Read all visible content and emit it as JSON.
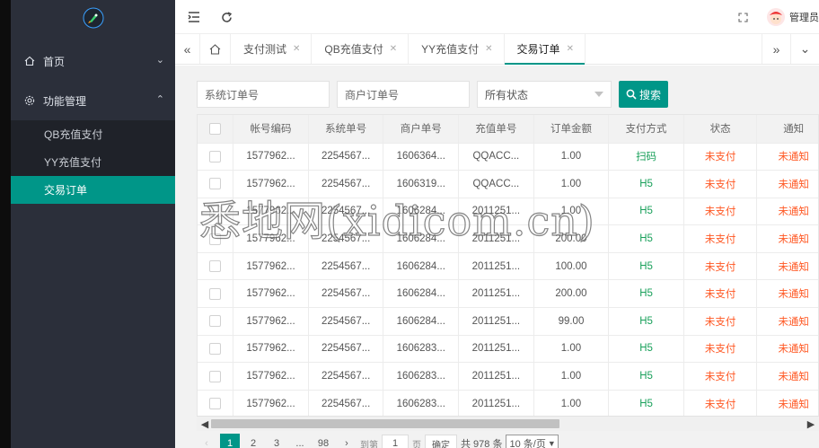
{
  "sidebar": {
    "menu": [
      {
        "label": "首页"
      },
      {
        "label": "功能管理"
      }
    ],
    "submenu": [
      {
        "label": "QB充值支付"
      },
      {
        "label": "YY充值支付"
      },
      {
        "label": "交易订单"
      }
    ]
  },
  "header": {
    "admin_label": "管理员"
  },
  "tabs": [
    {
      "label": "支付测试"
    },
    {
      "label": "QB充值支付"
    },
    {
      "label": "YY充值支付"
    },
    {
      "label": "交易订单"
    }
  ],
  "search": {
    "system_order_placeholder": "系统订单号",
    "merchant_order_placeholder": "商户订单号",
    "status_select": "所有状态",
    "search_button": "搜索"
  },
  "table": {
    "columns": [
      "帐号编码",
      "系统单号",
      "商户单号",
      "充值单号",
      "订单金额",
      "支付方式",
      "状态",
      "通知"
    ],
    "rows": [
      [
        "1577962...",
        "2254567...",
        "1606364...",
        "QQACC...",
        "1.00",
        "扫码",
        "未支付",
        "未通知"
      ],
      [
        "1577962...",
        "2254567...",
        "1606319...",
        "QQACC...",
        "1.00",
        "H5",
        "未支付",
        "未通知"
      ],
      [
        "1577962...",
        "2254567...",
        "1606284...",
        "2011251...",
        "1.00",
        "H5",
        "未支付",
        "未通知"
      ],
      [
        "1577962...",
        "2254567...",
        "1606284...",
        "2011251...",
        "200.00",
        "H5",
        "未支付",
        "未通知"
      ],
      [
        "1577962...",
        "2254567...",
        "1606284...",
        "2011251...",
        "100.00",
        "H5",
        "未支付",
        "未通知"
      ],
      [
        "1577962...",
        "2254567...",
        "1606284...",
        "2011251...",
        "200.00",
        "H5",
        "未支付",
        "未通知"
      ],
      [
        "1577962...",
        "2254567...",
        "1606284...",
        "2011251...",
        "99.00",
        "H5",
        "未支付",
        "未通知"
      ],
      [
        "1577962...",
        "2254567...",
        "1606283...",
        "2011251...",
        "1.00",
        "H5",
        "未支付",
        "未通知"
      ],
      [
        "1577962...",
        "2254567...",
        "1606283...",
        "2011251...",
        "1.00",
        "H5",
        "未支付",
        "未通知"
      ],
      [
        "1577962...",
        "2254567...",
        "1606283...",
        "2011251...",
        "1.00",
        "H5",
        "未支付",
        "未通知"
      ]
    ]
  },
  "pager": {
    "pages": [
      "1",
      "2",
      "3",
      "...",
      "98"
    ],
    "goto_label": "到第",
    "goto_value": "1",
    "page_suffix": "页",
    "confirm": "确定",
    "total": "共 978 条",
    "per_page": "10 条/页"
  },
  "watermark": "悉地网(xidicom.cn)",
  "colors": {
    "accent": "#009688",
    "sidebar": "#2b2f3a",
    "status_red": "#ff5722",
    "pay_green": "#19a05a"
  }
}
